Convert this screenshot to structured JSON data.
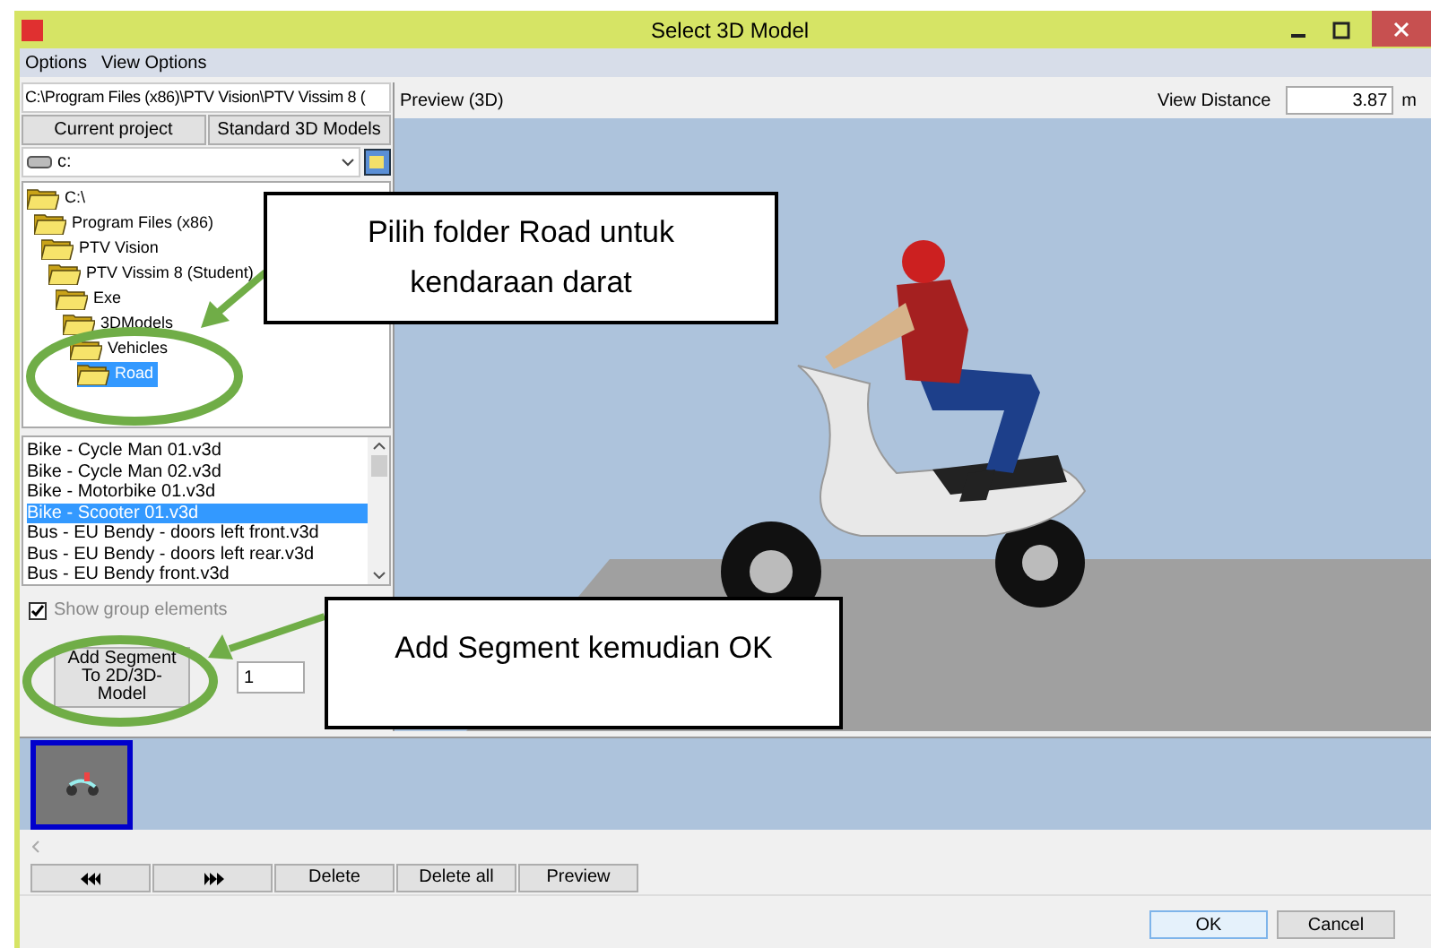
{
  "window": {
    "title": "Select 3D Model"
  },
  "menu": [
    "Options",
    "View Options"
  ],
  "path_field": {
    "value": "C:\\Program Files (x86)\\PTV Vision\\PTV Vissim 8 ("
  },
  "source_buttons": [
    "Current project",
    "Standard 3D Models"
  ],
  "drive_select": {
    "value": "c:"
  },
  "folder_tree": [
    {
      "label": "C:\\",
      "selected": false,
      "children": [
        {
          "label": "Program Files (x86)",
          "selected": false,
          "children": [
            {
              "label": "PTV Vision",
              "selected": false,
              "children": [
                {
                  "label": "PTV Vissim 8 (Student)",
                  "selected": false,
                  "children": [
                    {
                      "label": "Exe",
                      "selected": false,
                      "children": [
                        {
                          "label": "3DModels",
                          "selected": false,
                          "children": [
                            {
                              "label": "Vehicles",
                              "selected": false,
                              "children": [
                                {
                                  "label": "Road",
                                  "selected": true
                                }
                              ]
                            }
                          ]
                        }
                      ]
                    }
                  ]
                }
              ]
            }
          ]
        }
      ]
    }
  ],
  "files": [
    {
      "label": "Bike - Cycle Man 01.v3d",
      "selected": false
    },
    {
      "label": "Bike - Cycle Man 02.v3d",
      "selected": false
    },
    {
      "label": "Bike - Motorbike 01.v3d",
      "selected": false
    },
    {
      "label": "Bike - Scooter 01.v3d",
      "selected": true
    },
    {
      "label": "Bus - EU Bendy - doors left front.v3d",
      "selected": false
    },
    {
      "label": "Bus - EU Bendy - doors left rear.v3d",
      "selected": false
    },
    {
      "label": "Bus - EU Bendy front.v3d",
      "selected": false
    }
  ],
  "show_group_elements": {
    "label": "Show group elements",
    "checked": true
  },
  "add_segment_button": "Add Segment To 2D/3D-Model",
  "segment_count": "1",
  "preview": {
    "title": "Preview (3D)",
    "view_distance_label": "View Distance",
    "view_distance": "3.87",
    "unit": "m"
  },
  "segments": [
    {
      "selected": true
    }
  ],
  "segment_buttons": [
    {
      "kind": "first"
    },
    {
      "kind": "last"
    },
    {
      "kind": "text",
      "label": "Delete"
    },
    {
      "kind": "text",
      "label": "Delete all"
    },
    {
      "kind": "text",
      "label": "Preview"
    }
  ],
  "dialog_buttons": [
    {
      "label": "OK",
      "default": true
    },
    {
      "label": "Cancel",
      "default": false
    }
  ],
  "annotations": [
    "Pilih folder Road untuk kendaraan darat",
    "Add Segment kemudian OK"
  ]
}
